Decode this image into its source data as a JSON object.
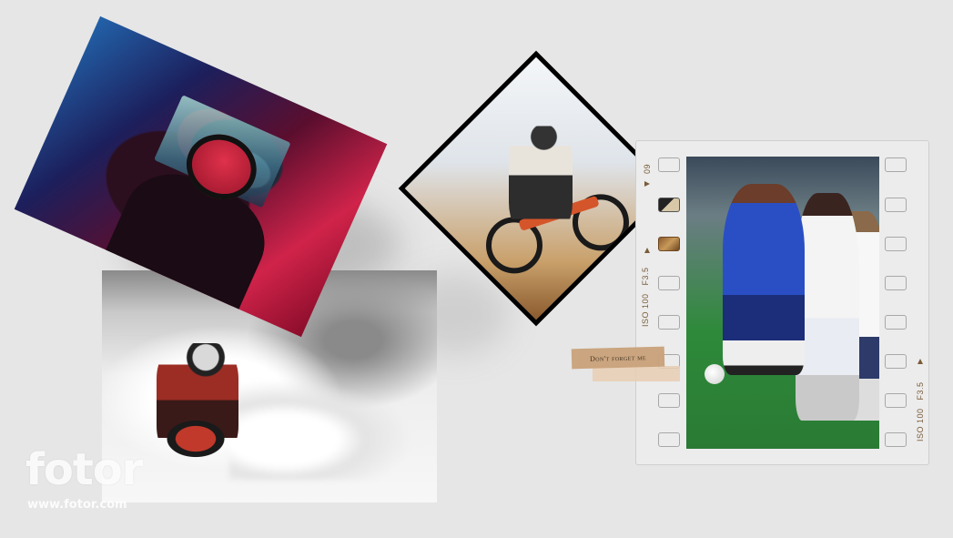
{
  "film_strip": {
    "top_label_left": "09",
    "label_left": "ISO 100   F3.5",
    "label_right": "ISO 100   F3.5"
  },
  "tape_label": "Don't forget me",
  "watermark": {
    "brand": "fotor",
    "url": "www.fotor.com"
  },
  "photos": [
    {
      "subject": "gaming-with-headphones"
    },
    {
      "subject": "snow-motocross"
    },
    {
      "subject": "mountain-biker"
    },
    {
      "subject": "soccer-match"
    }
  ],
  "colors": {
    "background": "#e6e6e6",
    "film_text": "#7a5c3a",
    "tape": "#c9a27a"
  }
}
